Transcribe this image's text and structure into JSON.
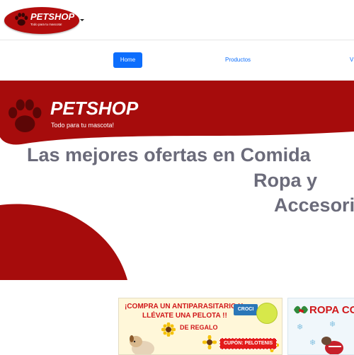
{
  "header": {
    "brand": "PETSHOP",
    "tagline": "Todo para tu mascota!",
    "brand_color": "#b30d0d"
  },
  "nav": {
    "items": [
      {
        "label": "Home",
        "active": true
      },
      {
        "label": "Productos",
        "active": false
      },
      {
        "label": "V",
        "active": false
      }
    ],
    "active_color": "#0d6efd"
  },
  "hero": {
    "brand": "PETSHOP",
    "tagline": "Todo para tu mascota!",
    "headline_lines": [
      "Las mejores ofertas en Comida",
      "Ropa y",
      "Accesori"
    ],
    "accent_color": "#a60c0c",
    "headline_color": "#6b6b7a",
    "icon": "paw-icon"
  },
  "promos": [
    {
      "line1": "¡COMPRA UN ANTIPARASITARIO Y",
      "line2": "LLÉVATE UNA PELOTA !!",
      "line3": "DE REGALO",
      "badge": "CROCI",
      "coupon": "CUPÓN: PELOTENIS"
    },
    {
      "title": "ROPA CO"
    }
  ]
}
